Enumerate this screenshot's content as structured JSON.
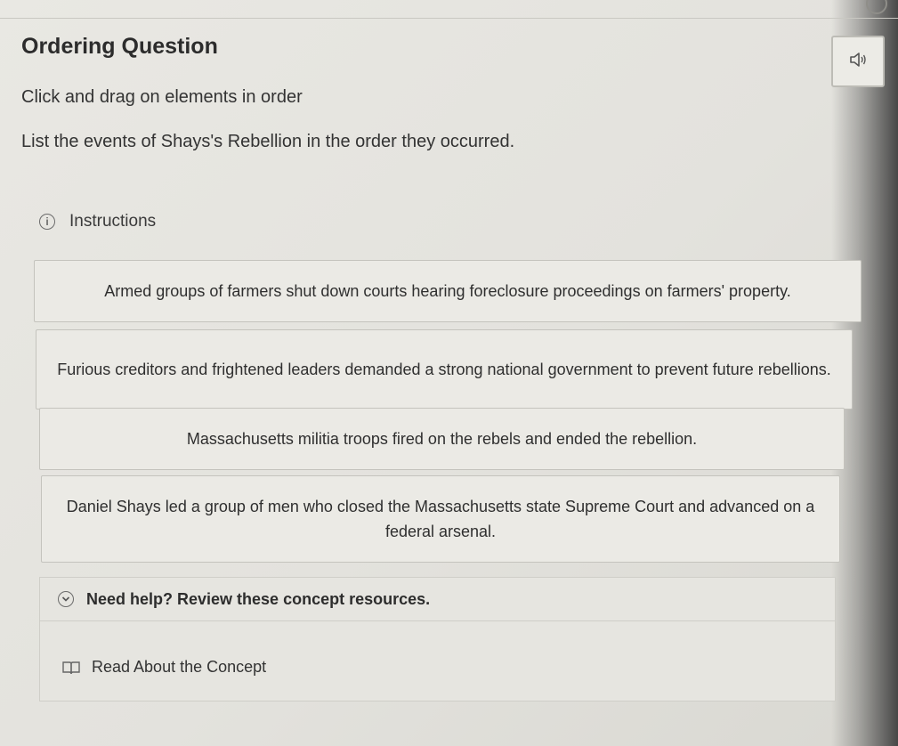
{
  "question": {
    "title": "Ordering Question",
    "subtitle": "Click and drag on elements in order",
    "prompt": "List the events of Shays's Rebellion in the order they occurred.",
    "instructions_label": "Instructions"
  },
  "order_items": [
    "Armed groups of farmers shut down courts hearing foreclosure proceedings on farmers' property.",
    "Furious creditors and frightened leaders demanded a strong national government to prevent future rebellions.",
    "Massachusetts militia troops fired on the rebels and ended the rebellion.",
    "Daniel Shays led a group of men who closed the Massachusetts state Supreme Court and advanced on a federal arsenal."
  ],
  "help": {
    "header": "Need help? Review these concept resources.",
    "link": "Read About the Concept"
  },
  "icons": {
    "audio": "speaker-icon",
    "info": "info-icon",
    "expand": "chevron-down-icon",
    "resource": "book-icon"
  }
}
